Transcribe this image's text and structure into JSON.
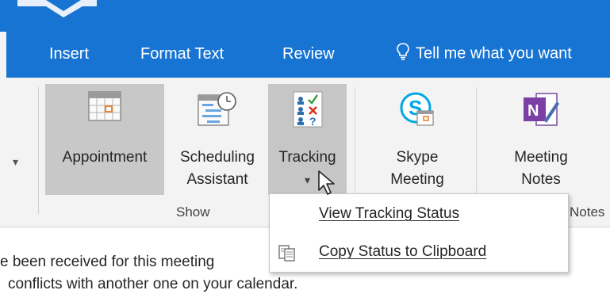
{
  "ribbon_tabs": [
    {
      "label": "Insert"
    },
    {
      "label": "Format Text"
    },
    {
      "label": "Review"
    }
  ],
  "tell_me": {
    "icon": "lightbulb-icon",
    "text": "Tell me what you want"
  },
  "buttons": {
    "appointment": {
      "label": "Appointment",
      "icon": "calendar-icon",
      "state": "selected"
    },
    "scheduling": {
      "line1": "Scheduling",
      "line2": "Assistant",
      "icon": "scheduling-icon"
    },
    "tracking": {
      "label": "Tracking",
      "icon": "tracking-icon",
      "dropdown": "▾",
      "state": "hover"
    },
    "skype": {
      "line1": "Skype",
      "line2": "Meeting",
      "icon": "skype-icon"
    },
    "meeting_notes": {
      "line1": "Meeting",
      "line2": "Notes",
      "icon": "onenote-icon"
    }
  },
  "groups": {
    "show": "Show",
    "notes_partial": "Notes"
  },
  "dropdown_menu": {
    "items": [
      {
        "label": "View Tracking Status"
      },
      {
        "label": "Copy Status to Clipboard",
        "icon": "clipboard-icon"
      }
    ]
  },
  "info": {
    "line1": "e been received for this meeting",
    "line2": "conflicts with another one on your calendar."
  },
  "colors": {
    "brand": "#1874d2",
    "ribbon": "#f3f3f3",
    "selected": "#c8c8c8"
  }
}
